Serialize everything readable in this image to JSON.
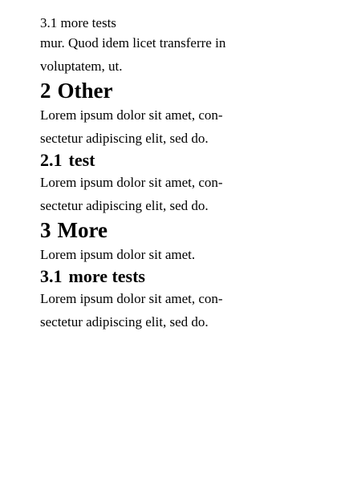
{
  "running_header": "3.1 more tests",
  "continuation": {
    "line1": "mur. Quod idem licet transferre in",
    "line2": "voluptatem, ut."
  },
  "sections": [
    {
      "number": "2",
      "title": "Other",
      "body_line1": "Lorem ipsum dolor sit amet, con-",
      "body_line2": "sectetur adipiscing elit, sed do.",
      "subsections": [
        {
          "number": "2.1",
          "title": "test",
          "body_line1": "Lorem ipsum dolor sit amet, con-",
          "body_line2": "sectetur adipiscing elit, sed do."
        }
      ]
    },
    {
      "number": "3",
      "title": "More",
      "body_line1": "Lorem ipsum dolor sit amet.",
      "subsections": [
        {
          "number": "3.1",
          "title": "more tests",
          "body_line1": "Lorem ipsum dolor sit amet, con-",
          "body_line2": "sectetur adipiscing elit, sed do."
        }
      ]
    }
  ]
}
